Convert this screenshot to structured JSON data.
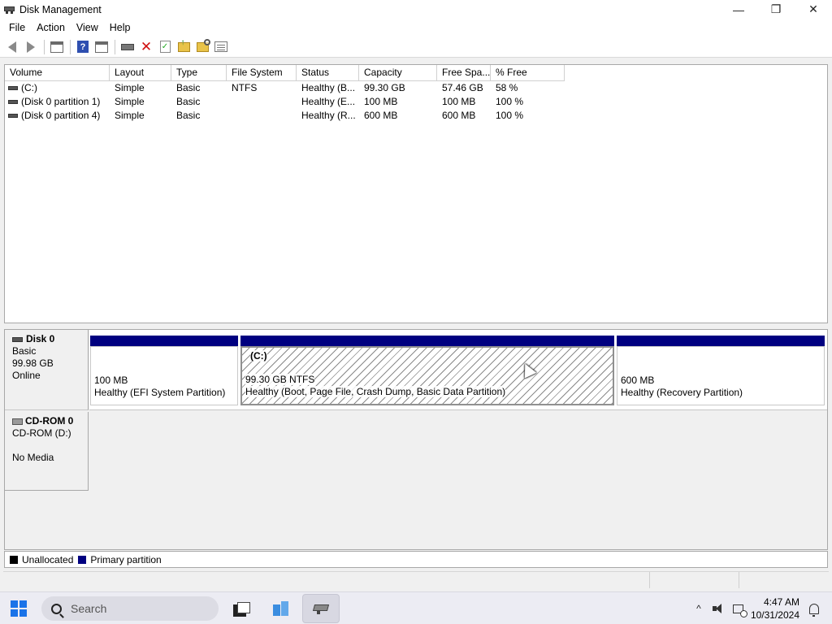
{
  "window": {
    "title": "Disk Management",
    "controls": {
      "minimize": "—",
      "maximize": "❐",
      "close": "✕"
    }
  },
  "menu": [
    "File",
    "Action",
    "View",
    "Help"
  ],
  "volume_table": {
    "columns": [
      "Volume",
      "Layout",
      "Type",
      "File System",
      "Status",
      "Capacity",
      "Free Spa...",
      "% Free"
    ],
    "rows": [
      [
        "(C:)",
        "Simple",
        "Basic",
        "NTFS",
        "Healthy (B...",
        "99.30 GB",
        "57.46 GB",
        "58 %"
      ],
      [
        "(Disk 0 partition 1)",
        "Simple",
        "Basic",
        "",
        "Healthy (E...",
        "100 MB",
        "100 MB",
        "100 %"
      ],
      [
        "(Disk 0 partition 4)",
        "Simple",
        "Basic",
        "",
        "Healthy (R...",
        "600 MB",
        "600 MB",
        "100 %"
      ]
    ]
  },
  "disks": {
    "disk0": {
      "name": "Disk 0",
      "type": "Basic",
      "size": "99.98 GB",
      "state": "Online",
      "partitions": [
        {
          "size": "100 MB",
          "status": "Healthy (EFI System Partition)"
        },
        {
          "label": "(C:)",
          "size": "99.30 GB NTFS",
          "status": "Healthy (Boot, Page File, Crash Dump, Basic Data Partition)"
        },
        {
          "size": "600 MB",
          "status": "Healthy (Recovery Partition)"
        }
      ]
    },
    "cdrom0": {
      "name": "CD-ROM 0",
      "drive": "CD-ROM (D:)",
      "media": "No Media"
    }
  },
  "legend": [
    {
      "label": "Unallocated",
      "color": "#000000"
    },
    {
      "label": "Primary partition",
      "color": "#000080"
    }
  ],
  "taskbar": {
    "search_placeholder": "Search",
    "time": "4:47 AM",
    "date": "10/31/2024",
    "overflow_chevron": "^"
  }
}
